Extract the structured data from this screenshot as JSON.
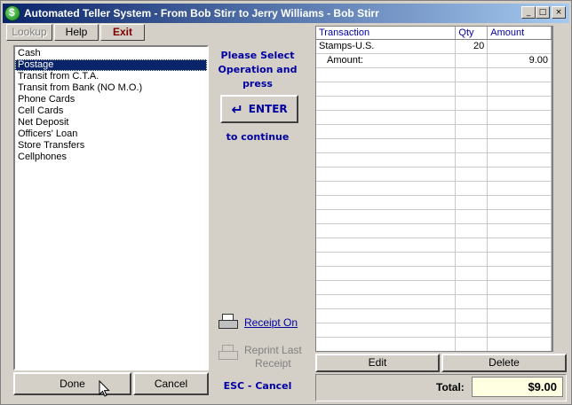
{
  "window": {
    "title": "Automated Teller System - From Bob Stirr to Jerry Williams - Bob Stirr",
    "minimize": "_",
    "maximize": "□",
    "close": "×"
  },
  "menu": {
    "lookup": "Lookup",
    "help": "Help",
    "exit": "Exit"
  },
  "operations": {
    "items": [
      "Cash",
      "Postage",
      "Transit from C.T.A.",
      "Transit from Bank (NO M.O.)",
      "Phone Cards",
      "Cell Cards",
      "Net Deposit",
      "Officers' Loan",
      "Store Transfers",
      "Cellphones"
    ],
    "selected": "Postage"
  },
  "prompt": {
    "line1": "Please Select",
    "line2": "Operation and",
    "line3": "press",
    "enter_label": "ENTER",
    "continue": "to continue",
    "receipt_on": "Receipt On",
    "reprint_line1": "Reprint Last",
    "reprint_line2": "Receipt",
    "esc_cancel": "ESC - Cancel"
  },
  "buttons": {
    "done": "Done",
    "cancel": "Cancel",
    "edit": "Edit",
    "delete": "Delete"
  },
  "transactions": {
    "columns": [
      "Transaction",
      "Qty",
      "Amount"
    ],
    "rows": [
      {
        "transaction": "Stamps-U.S.",
        "qty": "20",
        "amount": ""
      },
      {
        "transaction": "Amount:",
        "qty": "",
        "amount": "9.00"
      }
    ]
  },
  "total": {
    "label": "Total:",
    "value": "$9.00"
  },
  "colors": {
    "title_bar_start": "#0a246a",
    "prompt_text": "#0000a0",
    "exit_text": "#800000",
    "total_bg": "#ffffe1"
  }
}
